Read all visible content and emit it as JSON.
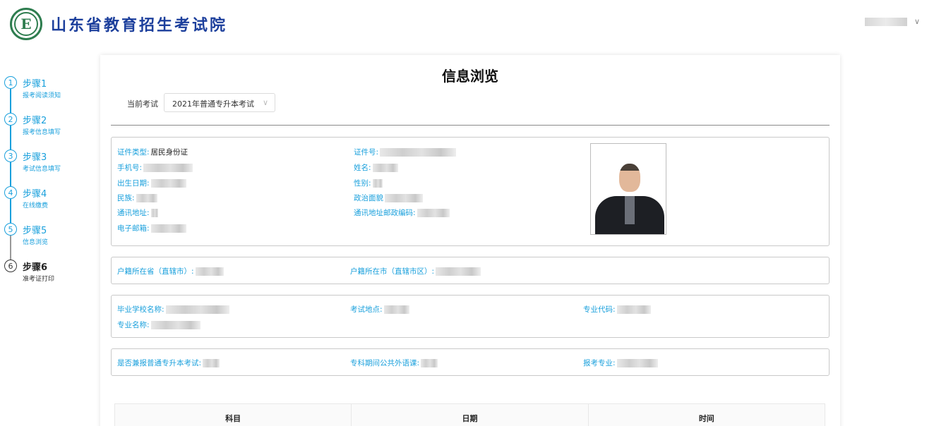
{
  "header": {
    "logo_letter": "E",
    "site_title": "山东省教育招生考试院",
    "user_caret": "∨"
  },
  "steps": [
    {
      "num": "1",
      "title": "步骤1",
      "desc": "报考阅读须知"
    },
    {
      "num": "2",
      "title": "步骤2",
      "desc": "报考信息填写"
    },
    {
      "num": "3",
      "title": "步骤3",
      "desc": "考试信息填写"
    },
    {
      "num": "4",
      "title": "步骤4",
      "desc": "在线缴费"
    },
    {
      "num": "5",
      "title": "步骤5",
      "desc": "信息浏览"
    },
    {
      "num": "6",
      "title": "步骤6",
      "desc": "准考证打印"
    }
  ],
  "main": {
    "title": "信息浏览",
    "exam_label": "当前考试",
    "exam_select_value": "2021年普通专升本考试",
    "exam_select_caret": "∨",
    "personal": {
      "id_type_label": "证件类型:",
      "id_type_value": "居民身份证",
      "id_no_label": "证件号:",
      "phone_label": "手机号:",
      "name_label": "姓名:",
      "birth_label": "出生日期:",
      "gender_label": "性别:",
      "ethnic_label": "民族:",
      "political_label": "政治面貌",
      "address_label": "通讯地址:",
      "postcode_label": "通讯地址邮政编码:",
      "email_label": "电子邮箱:"
    },
    "household": {
      "province_label": "户籍所在省（直辖市）:",
      "city_label": "户籍所在市（直辖市区）:"
    },
    "school": {
      "school_label": "毕业学校名称:",
      "exam_place_label": "考试地点:",
      "major_code_label": "专业代码:",
      "major_name_label": "专业名称:"
    },
    "extra": {
      "also_apply_label": "是否兼报普通专升本考试:",
      "foreign_lang_label": "专科期间公共外语课:",
      "apply_major_label": "报考专业:"
    },
    "table_headers": [
      "科目",
      "日期",
      "时间"
    ]
  }
}
